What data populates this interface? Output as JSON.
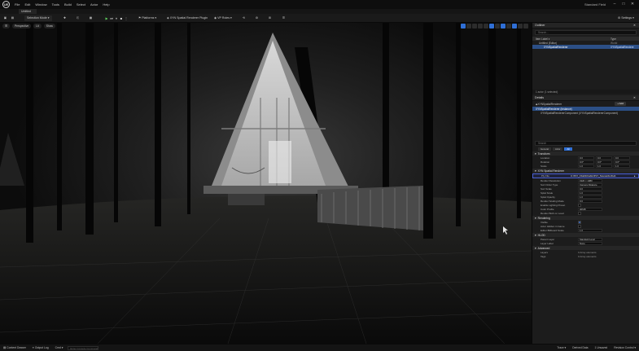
{
  "app": {
    "logo_text": "UE",
    "project_title": "Standard Field",
    "window_controls": [
      "–",
      "□",
      "✕"
    ]
  },
  "menu": [
    "File",
    "Edit",
    "Window",
    "Tools",
    "Build",
    "Select",
    "Actor",
    "Help"
  ],
  "tabs": [
    {
      "label": "Untitled"
    }
  ],
  "toolbar": {
    "mode_label": "Selection Mode",
    "platforms_label": "Platforms",
    "plugin_label": "XYN Spatial Renderer Plugin",
    "vp_label": "VP Roles",
    "settings_label": "Settings"
  },
  "viewport": {
    "perspective_label": "Perspective",
    "lit_label": "Lit",
    "show_label": "Show"
  },
  "outliner": {
    "tab_label": "Outliner",
    "search_placeholder": "Search...",
    "filter_label": "Item Label ▾",
    "type_header": "Type",
    "rows": [
      {
        "label": "Untitled (Editor)",
        "type": "World"
      },
      {
        "label": "XYNSpatialRenderer",
        "type": "XYNSpatialRendere"
      }
    ],
    "count_label": "1 actor (1 selected)"
  },
  "details": {
    "tab_label": "Details",
    "actor_name": "XYNSpatialRenderer",
    "add_label": "+ Add",
    "component_instance": "XYNSpatialRenderer (Instance)",
    "component_child": "XYNSpatialRendererComponent (XYNSpatialRendererComponent)",
    "search_placeholder": "Search",
    "filter_tags": [
      "General",
      "Actor",
      "All"
    ],
    "transform_section": "Transform",
    "transform_rows": [
      {
        "label": "Location",
        "x": "0.0",
        "y": "0.0",
        "z": "0.0"
      },
      {
        "label": "Rotation",
        "x": "0.0°",
        "y": "0.0°",
        "z": "0.0°"
      },
      {
        "label": "Scale",
        "x": "1.0",
        "y": "1.0",
        "z": "1.0"
      }
    ],
    "xyn_section": "XYN Spatial Renderer",
    "ply_path_label": "Ply File",
    "ply_path_value": "C:/PLY_FILES/Cabin/PLY_Scene/ALOHA",
    "props": [
      {
        "label": "Render Resolution",
        "value": "1920 × 1080"
      },
      {
        "label": "Sort Order Type",
        "value": "Camera Distance"
      },
      {
        "label": "Sort Scale",
        "value": "0.0"
      },
      {
        "label": "Splat Scale",
        "value": "1.0"
      },
      {
        "label": "Splat Opacity",
        "value": "1.0"
      },
      {
        "label": "Render Scaling Mode",
        "value": "0.0"
      },
      {
        "label": "Enable Lighting Preset",
        "value": ""
      },
      {
        "label": "Color Profile",
        "value": "sRGB"
      },
      {
        "label": "Render Both on Load",
        "value": ""
      }
    ],
    "rendering_section": "Rendering",
    "rendering_props": [
      {
        "label": "Visible"
      },
      {
        "label": "Actor Hidden in Game"
      },
      {
        "label": "Editor Billboard Scale",
        "value": "1.0"
      }
    ],
    "hlod_section": "HLOD",
    "hlod_props": [
      {
        "label": "Parent Layer",
        "value": "Standard Level"
      },
      {
        "label": "Layer Label",
        "value": "None"
      }
    ],
    "advanced_section": "Advanced",
    "advanced_props": [
      {
        "label": "Layers",
        "value": "0 Array elements"
      },
      {
        "label": "Tags",
        "value": "0 Array elements"
      }
    ]
  },
  "statusbar": {
    "content_drawer": "Content Drawer",
    "output_log": "Output Log",
    "cmd_label": "Cmd ▾",
    "cmd_placeholder": "Enter Console Command",
    "trace_label": "Trace ▾",
    "derived_data": "Derived Data",
    "unsaved": "1 Unsaved",
    "revision_control": "Revision Control ▾"
  }
}
